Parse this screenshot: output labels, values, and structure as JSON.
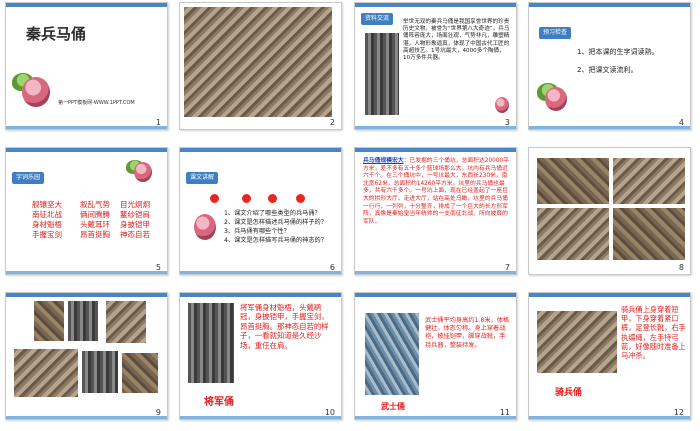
{
  "slides": {
    "s1": {
      "title": "秦兵马俑",
      "footer": "第一PPT模板网-WWW.1PPT.COM",
      "num": "1"
    },
    "s2": {
      "num": "2"
    },
    "s3": {
      "tag": "资料交流",
      "text": "举世无双的秦兵马俑是我国享誉世界的珍贵历史文物，被誉为“世界第八大奇迹”。兵马俑阵容庞大，场面壮观，气势非凡，雕塑精湛，人物形象逼真，体现了中国古代工匠的高超技艺。1号坑最大，4000多个陶俑，10万多件兵器。",
      "num": "3"
    },
    "s4": {
      "tag": "预习检查",
      "items": [
        "1、把本课的生字词读熟。",
        "2、把课文读流利。"
      ],
      "num": "4"
    },
    "s5": {
      "tag": "字词乐园",
      "col1": [
        "舰镶坚大",
        "南征北战",
        "身材魁梧",
        "手握宝剑"
      ],
      "col2": [
        "叙乱气势",
        "俩间腾腾",
        "头戴耳环",
        "昂首挺胸"
      ],
      "col3": [
        "目光炯炯",
        "鳌纱铠肩",
        "身披铠甲",
        "神态自若"
      ],
      "num": "5"
    },
    "s6": {
      "tag": "课文讲解",
      "items": [
        "1、课文介绍了哪些类型的兵马俑？",
        "2、课文是怎样描述兵马俑的样子的？",
        "3、兵马俑有哪些个性？",
        "4、课文是怎样描写兵马俑的神态的？"
      ],
      "num": "6"
    },
    "s7": {
      "lead": "兵马俑规模宏大",
      "text": "：已发掘的三个俑坑，总面积达20000平方米，差不多有五十多个篮球场那么大。坑内有兵马俑近六千个。在三个俑坑中，一号坑最大，东西长230米，南北宽62米，总面积约14260平方米。坑里的兵马俑也最多，共有六千多个。一号坑上面，现在已经盖起了一座巨大的拱形大厅。走进大厅，站在高处乌瞰，坑里的兵马俑一行行，一列列，十分整齐，排成了一个巨大的长方形军阵，真像是秦始皇当年统帅的一支南征北战、所向披靡的军队。",
      "num": "7"
    },
    "s8": {
      "num": "8"
    },
    "s9": {
      "num": "9"
    },
    "s10": {
      "caption": "将军俑",
      "text": "将军俑身材魁梧，头戴鹖冠，身披铠甲，手握宝剑，昂首挺胸。那神态自若的样子，一看就知道是久经沙场，重任在肩。",
      "num": "10"
    },
    "s11": {
      "caption": "武士俑",
      "text": "武士俑平均身高约1.8米，体格健壮，体态匀称。身上穿着战袍，披挂铠甲，脚穿战靴，手持兵器，整装待发。",
      "num": "11"
    },
    "s12": {
      "caption": "骑兵俑",
      "text": "骑兵俑上身穿着短甲，下身穿着紧口裤，足登长靴，右手执缰绳，左手持弓箭，好像随时准备上马冲杀。",
      "num": "12"
    }
  },
  "colors": {
    "accent": "#4a86c5",
    "red": "#e01e1e",
    "blue": "#1a3fd6"
  }
}
